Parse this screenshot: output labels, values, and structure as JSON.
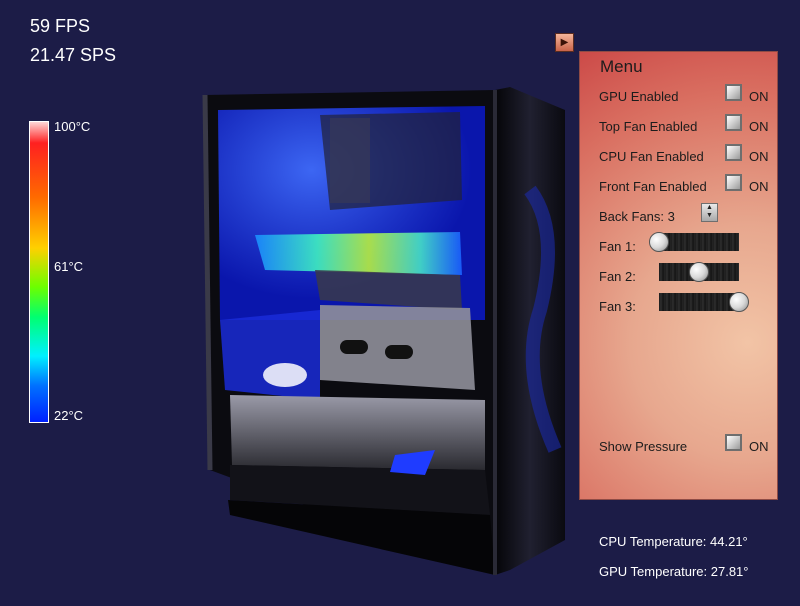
{
  "stats": {
    "fps": "59 FPS",
    "sps": "21.47 SPS"
  },
  "legend": {
    "max": "100°C",
    "mid": "61°C",
    "min": "22°C"
  },
  "menu": {
    "title": "Menu",
    "toggles": [
      {
        "label": "GPU Enabled",
        "state": "ON"
      },
      {
        "label": "Top Fan Enabled",
        "state": "ON"
      },
      {
        "label": "CPU Fan Enabled",
        "state": "ON"
      },
      {
        "label": "Front Fan Enabled",
        "state": "ON"
      }
    ],
    "back_fans_label": "Back Fans: 3",
    "fans": [
      {
        "label": "Fan 1:",
        "value": 0
      },
      {
        "label": "Fan 2:",
        "value": 0.5
      },
      {
        "label": "Fan 3:",
        "value": 1
      }
    ],
    "pressure": {
      "label": "Show Pressure",
      "state": "ON"
    }
  },
  "readouts": {
    "cpu_temp": "CPU Temperature: 44.21°",
    "gpu_temp": "GPU Temperature: 27.81°"
  }
}
